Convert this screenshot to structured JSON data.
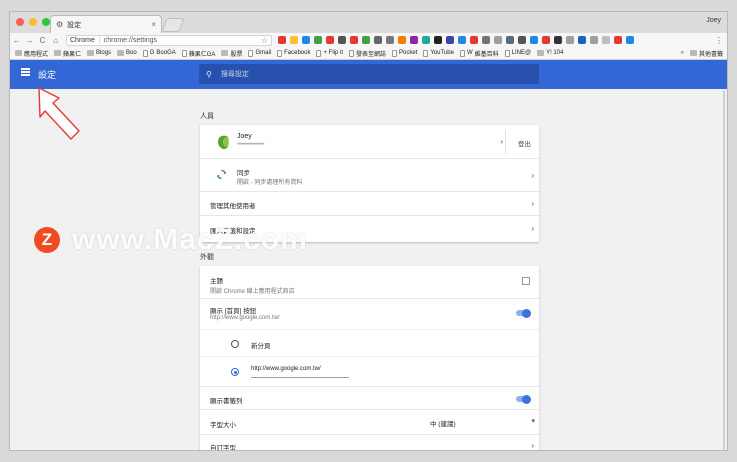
{
  "tab": {
    "title": "設定",
    "close": "×"
  },
  "user": "Joey",
  "address": {
    "label": "Chrome",
    "url": "chrome://settings"
  },
  "nav": {
    "back": "←",
    "forward": "→",
    "reload": "C",
    "home": "⌂"
  },
  "bookmarks": [
    {
      "type": "folder",
      "label": "應用程式"
    },
    {
      "type": "folder",
      "label": "蘋果仁"
    },
    {
      "type": "folder",
      "label": "Blogs"
    },
    {
      "type": "folder",
      "label": "Boo"
    },
    {
      "type": "page",
      "label": "BooGA",
      "prefix": "G"
    },
    {
      "type": "page",
      "label": "蘋果仁GA"
    },
    {
      "type": "folder",
      "label": "股票"
    },
    {
      "type": "page",
      "label": "Gmail"
    },
    {
      "type": "page",
      "label": "Facebook"
    },
    {
      "type": "page",
      "label": "+ Flip it"
    },
    {
      "type": "page",
      "label": "發表至網誌"
    },
    {
      "type": "page",
      "label": "Pocket"
    },
    {
      "type": "page",
      "label": "YouTube"
    },
    {
      "type": "page",
      "label": "維基百科",
      "prefix": "W"
    },
    {
      "type": "page",
      "label": "LINE@"
    },
    {
      "type": "folder",
      "label": "Y! 104"
    }
  ],
  "bookmarks_more": "»",
  "bookmarks_other": "其他書籤",
  "settings": {
    "title": "設定",
    "search_placeholder": "搜尋設定",
    "people": {
      "heading": "人員",
      "name": "Joey",
      "email": "••••••••••••••••••••••••",
      "signout": "登出",
      "sync_title": "同步",
      "sync_sub": "開啟 - 同步處理所有資料",
      "manage_users": "管理其他使用者",
      "import": "匯入書籤和設定"
    },
    "appearance": {
      "heading": "外觀",
      "theme_title": "主題",
      "theme_sub": "開啟 Chrome 線上應用程式商店",
      "home_title": "顯示 [首頁] 按鈕",
      "home_sub": "http://www.google.com.tw/",
      "home_toggle": true,
      "radio_newtab": "新分頁",
      "radio_custom": "http://www.google.com.tw/",
      "selected_radio": "custom",
      "bookmarks_bar": "顯示書籤列",
      "bookmarks_toggle": true,
      "font_size": "字型大小",
      "font_size_value": "中 (建議)",
      "custom_fonts": "自訂字型"
    }
  },
  "watermark": {
    "badge": "Z",
    "text": "www.MacZ.com"
  },
  "colors": {
    "header": "#3367d6",
    "accent": "#3367d6",
    "watermark_badge": "#ef4b23"
  }
}
